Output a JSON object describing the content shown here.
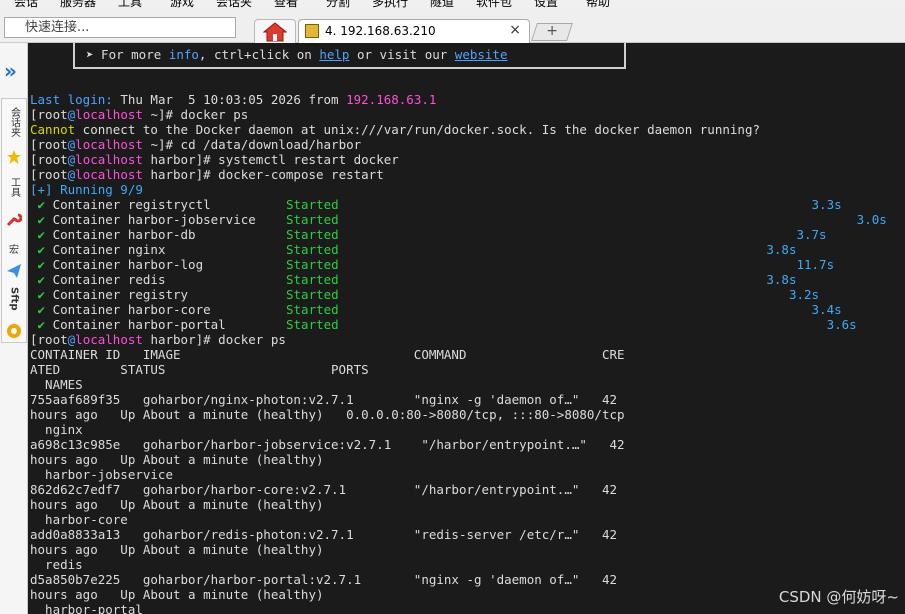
{
  "menu": [
    "会话",
    "服务器",
    "工具",
    "游戏",
    "会话夹",
    "查看",
    "分割",
    "多执行",
    "隧道",
    "软件包",
    "设置",
    "帮助"
  ],
  "toolbar": {
    "quick_connect_placeholder": "快速连接..."
  },
  "tabs": {
    "active_label": "4. 192.168.63.210",
    "close_glyph": "×",
    "new_tab_glyph": "+"
  },
  "sidebar": {
    "expand_glyph": "»",
    "items": [
      "会话夹",
      "工具",
      "宏",
      "Sftp"
    ]
  },
  "terminal": {
    "banner": {
      "prefix": "➤ For more ",
      "info": "info",
      "mid": ", ctrl+click on ",
      "help": "help",
      "mid2": " or visit our ",
      "website": "website"
    },
    "login": {
      "label": "Last login:",
      "time": " Thu Mar  5 10:03:05 2026 from ",
      "ip": "192.168.63.1"
    },
    "user": "root",
    "at": "@",
    "host": "localhost",
    "dirs": {
      "home": "~",
      "harbor": "harbor"
    },
    "commands": [
      "docker ps",
      "cd /data/download/harbor",
      "systemctl restart docker",
      "docker-compose restart",
      "docker ps"
    ],
    "error": {
      "word": "Cannot",
      "text": " connect to the Docker daemon at unix:///var/run/docker.sock. Is the docker daemon running?"
    },
    "running": "[+] Running 9/9",
    "containers": [
      {
        "name": "registryctl",
        "status": "Started",
        "time": "3.3s"
      },
      {
        "name": "harbor-jobservice",
        "status": "Started",
        "time": "3.0s"
      },
      {
        "name": "harbor-db",
        "status": "Started",
        "time": "3.7s"
      },
      {
        "name": "nginx",
        "status": "Started",
        "time": "3.8s"
      },
      {
        "name": "harbor-log",
        "status": "Started",
        "time": "11.7s"
      },
      {
        "name": "redis",
        "status": "Started",
        "time": "3.8s"
      },
      {
        "name": "registry",
        "status": "Started",
        "time": "3.2s"
      },
      {
        "name": "harbor-core",
        "status": "Started",
        "time": "3.4s"
      },
      {
        "name": "harbor-portal",
        "status": "Started",
        "time": "3.6s"
      }
    ],
    "ps_output": [
      "CONTAINER ID   IMAGE                               COMMAND                  CRE",
      "ATED        STATUS                      PORTS",
      "  NAMES",
      "755aaf689f35   goharbor/nginx-photon:v2.7.1        \"nginx -g 'daemon of…\"   42",
      "hours ago   Up About a minute (healthy)   0.0.0.0:80->8080/tcp, :::80->8080/tcp",
      "  nginx",
      "a698c13c985e   goharbor/harbor-jobservice:v2.7.1    \"/harbor/entrypoint.…\"   42",
      "hours ago   Up About a minute (healthy)",
      "  harbor-jobservice",
      "862d62c7edf7   goharbor/harbor-core:v2.7.1         \"/harbor/entrypoint.…\"   42",
      "hours ago   Up About a minute (healthy)",
      "  harbor-core",
      "add0a8833a13   goharbor/redis-photon:v2.7.1        \"redis-server /etc/r…\"   42",
      "hours ago   Up About a minute (healthy)",
      "  redis",
      "d5a850b7e225   goharbor/harbor-portal:v2.7.1       \"nginx -g 'daemon of…\"   42",
      "hours ago   Up About a minute (healthy)",
      "  harbor-portal"
    ]
  },
  "watermark": "CSDN @何妨呀~",
  "colors": {
    "background": "#1b1b1b",
    "prompt_user": "#4fa3ff",
    "host": "#ff4fd8",
    "started": "#2ecc40",
    "timing": "#3fa9f5",
    "error_word": "#d8d800"
  }
}
